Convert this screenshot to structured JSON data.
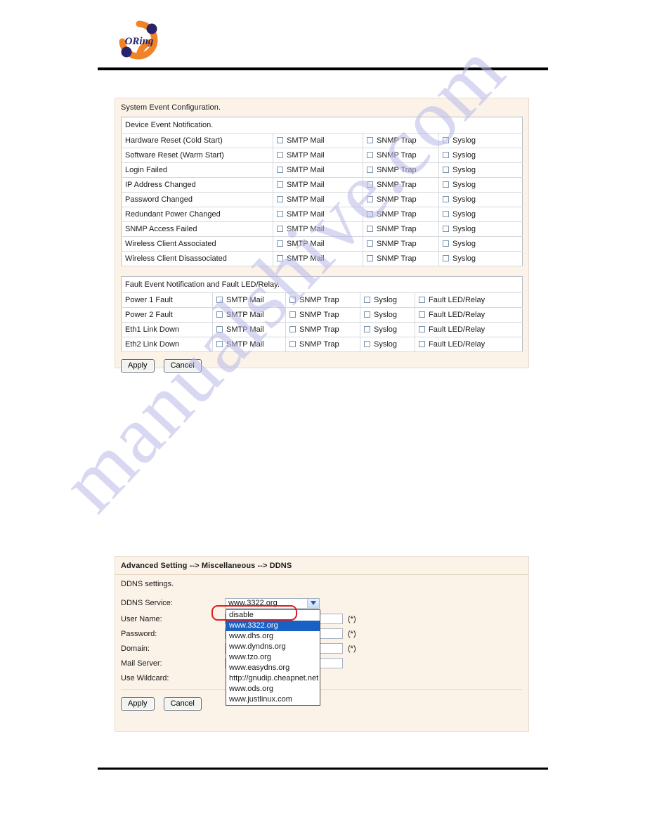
{
  "brand": {
    "logo_text": "ORing",
    "logo_ring_color": "#F08228",
    "logo_dot_color": "#27246B"
  },
  "system_event_panel": {
    "title": "System Event Configuration.",
    "device_section": {
      "heading": "Device Event Notification.",
      "option_labels": [
        "SMTP Mail",
        "SNMP Trap",
        "Syslog"
      ],
      "rows": [
        "Hardware Reset (Cold Start)",
        "Software Reset (Warm Start)",
        "Login Failed",
        "IP Address Changed",
        "Password Changed",
        "Redundant Power Changed",
        "SNMP Access Failed",
        "Wireless Client Associated",
        "Wireless Client Disassociated"
      ]
    },
    "fault_section": {
      "heading": "Fault Event Notification and Fault LED/Relay.",
      "option_labels": [
        "SMTP Mail",
        "SNMP Trap",
        "Syslog",
        "Fault LED/Relay"
      ],
      "rows": [
        "Power 1 Fault",
        "Power 2 Fault",
        "Eth1 Link Down",
        "Eth2 Link Down"
      ]
    },
    "buttons": {
      "apply": "Apply",
      "cancel": "Cancel"
    }
  },
  "ddns_panel": {
    "breadcrumb": "Advanced Setting --> Miscellaneous --> DDNS",
    "section_label": "DDNS settings.",
    "service_label": "DDNS Service:",
    "service_selected": "www.3322.org",
    "service_options": [
      "disable",
      "www.3322.org",
      "www.dhs.org",
      "www.dyndns.org",
      "www.tzo.org",
      "www.easydns.org",
      "http://gnudip.cheapnet.net",
      "www.ods.org",
      "www.justlinux.com"
    ],
    "highlighted_option": "www.3322.org",
    "annotated_option": "disable",
    "annotation_color": "#E01B1B",
    "fields": [
      {
        "label": "User Name:",
        "value": "",
        "required_mark": "(*)"
      },
      {
        "label": "Password:",
        "value": "",
        "required_mark": "(*)"
      },
      {
        "label": "Domain:",
        "value": "",
        "required_mark": "(*)"
      },
      {
        "label": "Mail Server:",
        "value": "",
        "required_mark": ""
      }
    ],
    "wildcard_label": "Use Wildcard:",
    "buttons": {
      "apply": "Apply",
      "cancel": "Cancel"
    }
  },
  "watermark": {
    "text": "manualshive.com",
    "color": "#B9B9E8"
  }
}
